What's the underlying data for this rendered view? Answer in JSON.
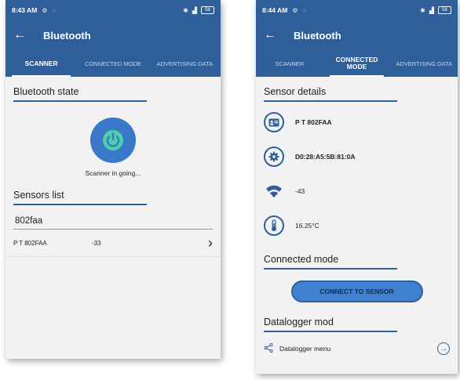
{
  "colors": {
    "primary": "#2e5f9a",
    "button": "#3f80d0",
    "power": "#3a78c8"
  },
  "left": {
    "status": {
      "time": "8:43 AM",
      "battery": "58"
    },
    "title": "Bluetooth",
    "tabs": [
      "SCANNER",
      "CONNECTED MODE",
      "ADVERTISING DATA"
    ],
    "state_title": "Bluetooth state",
    "scan_status": "Scanner in going...",
    "sensors_title": "Sensors list",
    "filter_value": "802faa",
    "sensors": [
      {
        "name": "P T 802FAA",
        "rssi": "-33"
      }
    ]
  },
  "right": {
    "status": {
      "time": "8:44 AM",
      "battery": "58"
    },
    "title": "Bluetooth",
    "tabs": [
      "SCANNER",
      "CONNECTED MODE",
      "ADVERTISING DATA"
    ],
    "details_title": "Sensor details",
    "sensor_name": "P T 802FAA",
    "mac": "D0:28:A5:5B:81:0A",
    "rssi": "-43",
    "temperature": "16.25°C",
    "connected_title": "Connected mode",
    "connect_button": "CONNECT TO SENSOR",
    "datalogger_title": "Datalogger mod",
    "datalogger_menu": "Datalogger menu"
  }
}
